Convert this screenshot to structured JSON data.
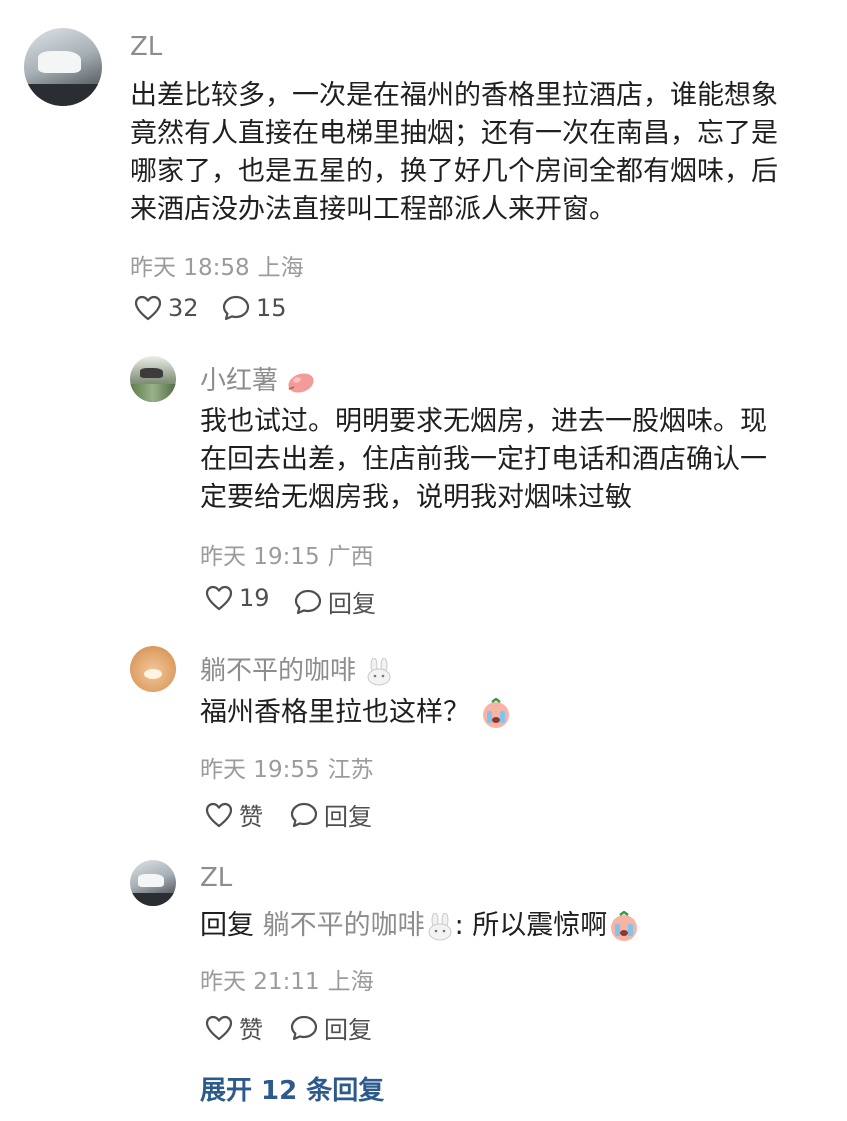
{
  "comments": [
    {
      "name": "ZL",
      "text_lines": [
        "出差比较多，一次是在福州的香格里拉酒店，谁能想象",
        "竟然有人直接在电梯里抽烟；还有一次在南昌，忘了是",
        "哪家了，也是五星的，换了好几个房间全都有烟味，后",
        "来酒店没办法直接叫工程部派人来开窗。"
      ],
      "time": "昨天 18:58",
      "location": "上海",
      "likes": "32",
      "replies": "15"
    },
    {
      "name": "小红薯",
      "text_lines": [
        "我也试过。明明要求无烟房，进去一股烟味。现",
        "在回去出差，住店前我一定打电话和酒店确认一",
        "定要给无烟房我，说明我对烟味过敏"
      ],
      "time": "昨天 19:15",
      "location": "广西",
      "likes": "19",
      "reply_label": "回复"
    },
    {
      "name": "躺不平的咖啡",
      "text": "福州香格里拉也这样？",
      "time": "昨天 19:55",
      "location": "江苏",
      "like_label": "赞",
      "reply_label": "回复"
    },
    {
      "name": "ZL",
      "reply_prefix": "回复",
      "reply_target": "躺不平的咖啡",
      "text": ": 所以震惊啊",
      "time": "昨天 21:11",
      "location": "上海",
      "like_label": "赞",
      "reply_label": "回复"
    }
  ],
  "expand_replies": "展开 12 条回复",
  "icons": [
    "heart-icon",
    "speech-bubble-icon",
    "sweet-potato-emoji",
    "rabbit-emoji",
    "crying-face-emoji"
  ]
}
